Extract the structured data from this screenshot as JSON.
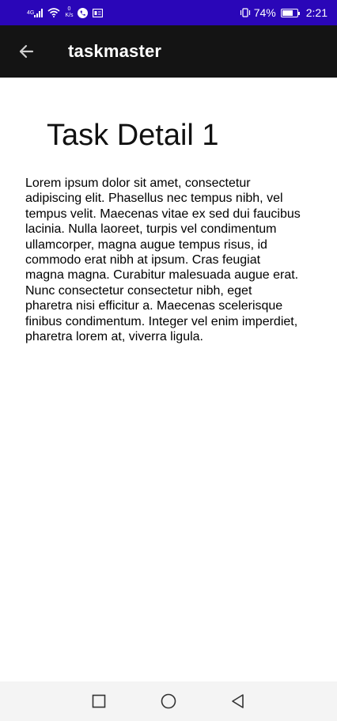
{
  "status_bar": {
    "network_type": "4G",
    "speed_value": "0",
    "speed_unit": "K/s",
    "battery_percent": "74%",
    "battery_level": 0.74,
    "time": "2:21",
    "icons": [
      "signal-icon",
      "wifi-icon",
      "call-icon",
      "notification-icon",
      "vibrate-icon",
      "battery-icon"
    ]
  },
  "app_bar": {
    "title": "taskmaster",
    "back_icon": "arrow-left-icon"
  },
  "task": {
    "title": "Task Detail 1",
    "body": "Lorem ipsum dolor sit amet, consectetur adipiscing elit. Phasellus nec tempus nibh, vel tempus velit. Maecenas vitae ex sed dui faucibus lacinia. Nulla laoreet, turpis vel condimentum ullamcorper, magna augue tempus risus, id commodo erat nibh at ipsum. Cras feugiat magna magna. Curabitur malesuada augue erat. Nunc consectetur consectetur nibh, eget pharetra nisi efficitur a. Maecenas scelerisque finibus condimentum. Integer vel enim imperdiet, pharetra lorem at, viverra ligula."
  },
  "nav_bar": {
    "buttons": [
      "recents-square-icon",
      "home-circle-icon",
      "back-triangle-icon"
    ]
  },
  "colors": {
    "status_bar": "#2a06b8",
    "app_bar": "#141414",
    "background": "#ffffff",
    "nav_bar": "#f4f4f4"
  }
}
